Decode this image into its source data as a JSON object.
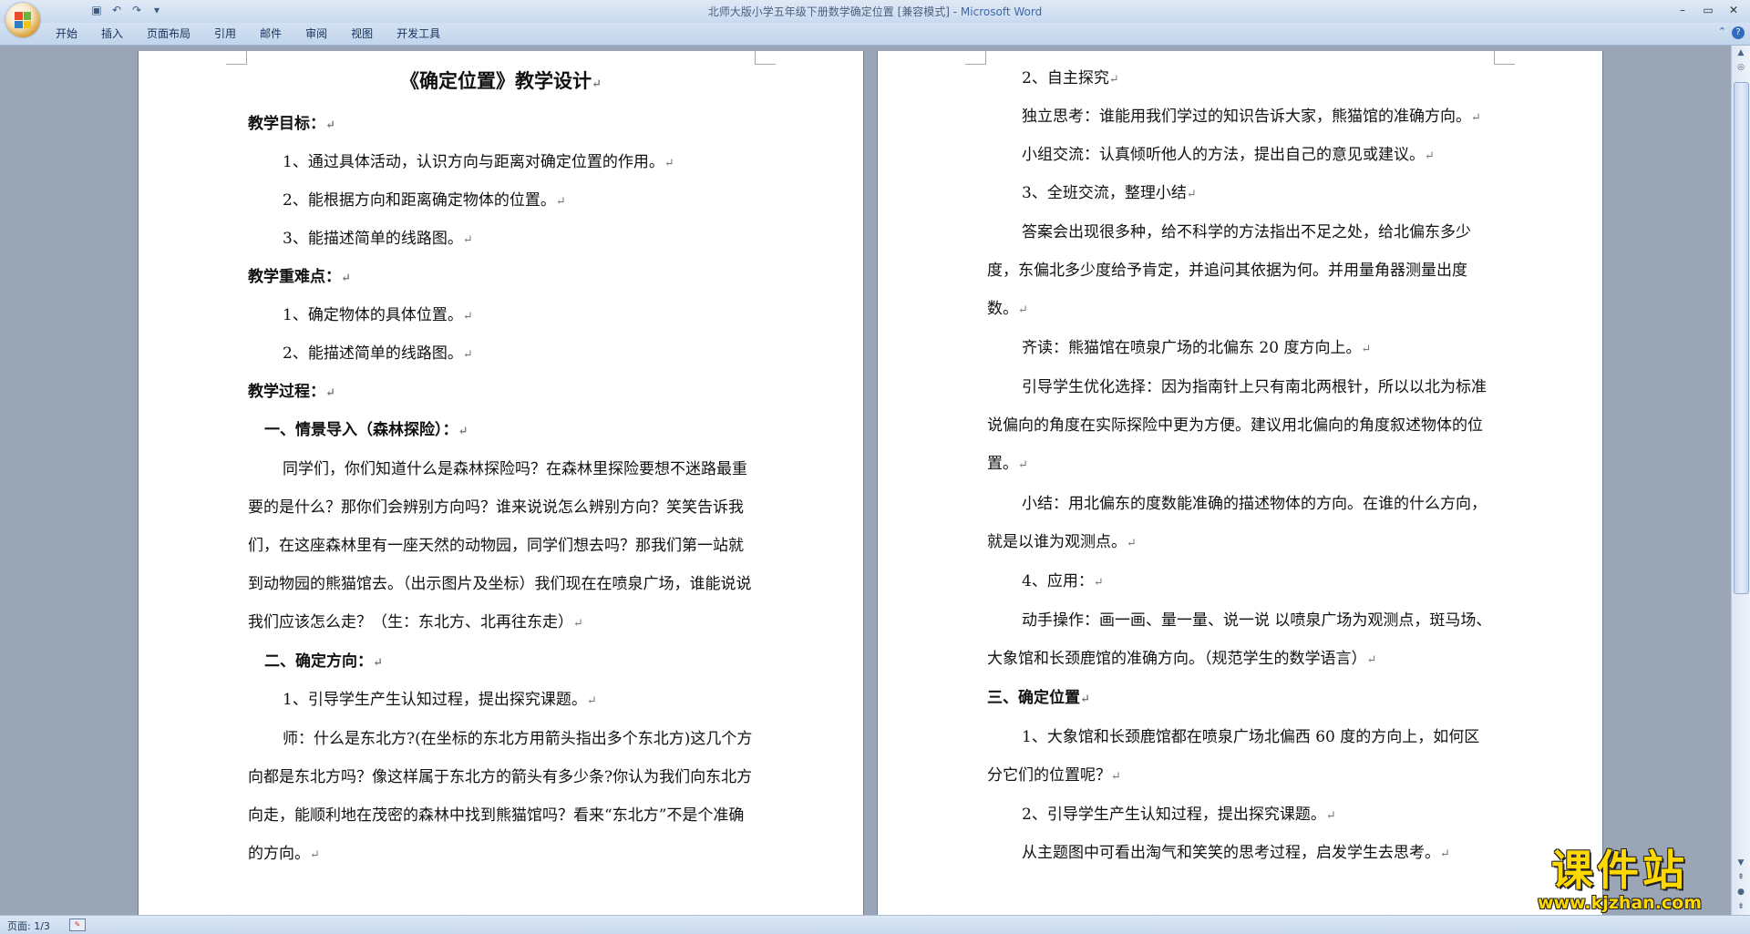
{
  "titlebar": {
    "doc_title": "北师大版小学五年级下册数学确定位置 [兼容模式] - ",
    "app_name": "Microsoft Word",
    "qat": {
      "save_icon": "save-icon",
      "undo_icon": "undo-icon",
      "redo_icon": "redo-icon",
      "more_icon": "chevron-down-icon"
    },
    "controls": {
      "minimize": "–",
      "restore": "▭",
      "close": "✕"
    }
  },
  "ribbon": {
    "tabs": [
      "开始",
      "插入",
      "页面布局",
      "引用",
      "邮件",
      "审阅",
      "视图",
      "开发工具"
    ],
    "help": "?"
  },
  "pages": {
    "left": {
      "title": "《确定位置》教学设计",
      "lines": [
        {
          "text": "教学目标：",
          "style": "bold"
        },
        {
          "text": "1、通过具体活动，认识方向与距离对确定位置的作用。",
          "style": "indent"
        },
        {
          "text": "2、能根据方向和距离确定物体的位置。",
          "style": "indent"
        },
        {
          "text": "3、能描述简单的线路图。",
          "style": "indent"
        },
        {
          "text": "教学重难点：",
          "style": "bold"
        },
        {
          "text": "1、确定物体的具体位置。",
          "style": "indent"
        },
        {
          "text": "2、能描述简单的线路图。",
          "style": "indent"
        },
        {
          "text": "教学过程：",
          "style": "bold"
        },
        {
          "text": "一、情景导入（森林探险）：",
          "style": "bold-sm"
        },
        {
          "text": "同学们，你们知道什么是森林探险吗？在森林里探险要想不迷路最重要的是什么？那你们会辨别方向吗？谁来说说怎么辨别方向？笑笑告诉我们，在这座森林里有一座天然的动物园，同学们想去吗？那我们第一站就到动物园的熊猫馆去。（出示图片及坐标）我们现在在喷泉广场，谁能说说我们应该怎么走？（生：东北方、北再往东走）",
          "style": "para"
        },
        {
          "text": "二、确定方向：",
          "style": "bold-sm"
        },
        {
          "text": "1、引导学生产生认知过程，提出探究课题。",
          "style": "indent"
        },
        {
          "text": "师：什么是东北方?(在坐标的东北方用箭头指出多个东北方)这几个方向都是东北方吗？像这样属于东北方的箭头有多少条?你认为我们向东北方向走，能顺利地在茂密的森林中找到熊猫馆吗？看来“东北方”不是个准确的方向。",
          "style": "para"
        }
      ]
    },
    "right": {
      "lines": [
        {
          "text": "2、自主探究",
          "style": "indent"
        },
        {
          "text": "独立思考：谁能用我们学过的知识告诉大家，熊猫馆的准确方向。",
          "style": "indent"
        },
        {
          "text": "小组交流：认真倾听他人的方法，提出自己的意见或建议。",
          "style": "indent"
        },
        {
          "text": "3、全班交流，整理小结",
          "style": "indent"
        },
        {
          "text": "答案会出现很多种，给不科学的方法指出不足之处，给北偏东多少度，东偏北多少度给予肯定，并追问其依据为何。并用量角器测量出度数。",
          "style": "para"
        },
        {
          "text": "齐读：熊猫馆在喷泉广场的北偏东 20 度方向上。",
          "style": "indent"
        },
        {
          "text": "引导学生优化选择：因为指南针上只有南北两根针，所以以北为标准说偏向的角度在实际探险中更为方便。建议用北偏向的角度叙述物体的位置。",
          "style": "para"
        },
        {
          "text": "小结：用北偏东的度数能准确的描述物体的方向。在谁的什么方向，就是以谁为观测点。",
          "style": "para"
        },
        {
          "text": "4、应用：",
          "style": "indent"
        },
        {
          "text": "动手操作：画一画、量一量、说一说 以喷泉广场为观测点，斑马场、大象馆和长颈鹿馆的准确方向。（规范学生的数学语言）",
          "style": "para"
        },
        {
          "text": "三、确定位置",
          "style": "bold"
        },
        {
          "text": "1、大象馆和长颈鹿馆都在喷泉广场北偏西 60 度的方向上，如何区分它们的位置呢？",
          "style": "para"
        },
        {
          "text": "2、引导学生产生认知过程，提出探究课题。",
          "style": "indent"
        },
        {
          "text": "从主题图中可看出淘气和笑笑的思考过程，启发学生去思考。",
          "style": "indent"
        }
      ]
    }
  },
  "status": {
    "page": "页面: 1/3"
  },
  "watermark": {
    "big": "课件站",
    "url": "www.kjzhan.com"
  },
  "colors": {
    "ribbon_bg": "#c9daf0",
    "workspace": "#9aa5b5",
    "watermark": "#ffd800"
  }
}
